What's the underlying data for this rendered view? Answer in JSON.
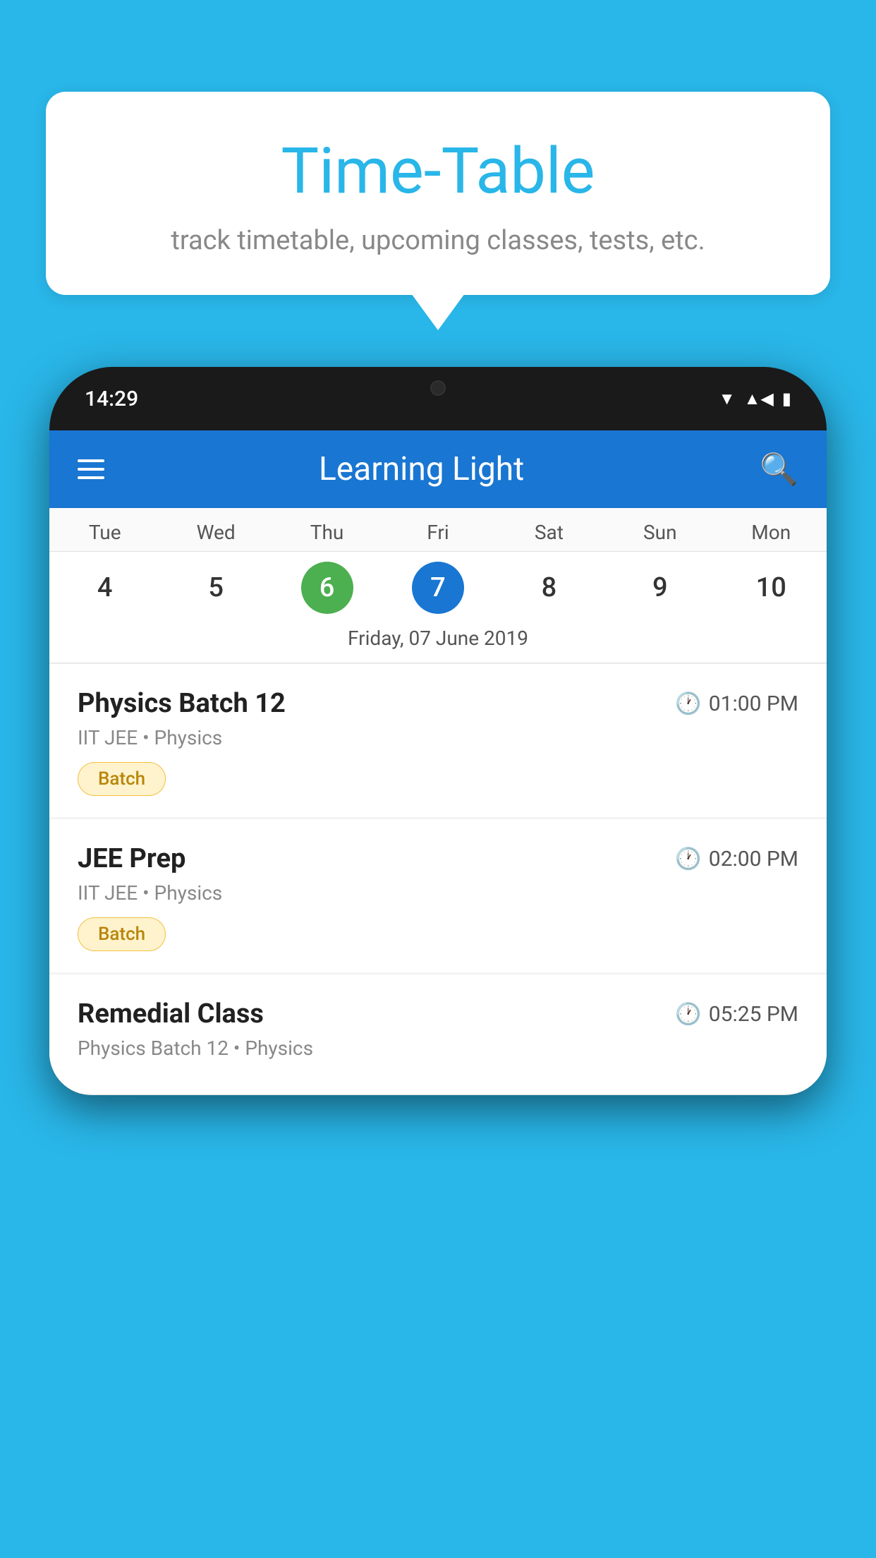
{
  "background_color": "#29B6E8",
  "speech_bubble": {
    "title": "Time-Table",
    "subtitle": "track timetable, upcoming classes, tests, etc."
  },
  "phone": {
    "time": "14:29",
    "app_bar": {
      "title": "Learning Light"
    },
    "calendar": {
      "days": [
        {
          "name": "Tue",
          "number": "4",
          "state": "normal"
        },
        {
          "name": "Wed",
          "number": "5",
          "state": "normal"
        },
        {
          "name": "Thu",
          "number": "6",
          "state": "today"
        },
        {
          "name": "Fri",
          "number": "7",
          "state": "selected"
        },
        {
          "name": "Sat",
          "number": "8",
          "state": "normal"
        },
        {
          "name": "Sun",
          "number": "9",
          "state": "normal"
        },
        {
          "name": "Mon",
          "number": "10",
          "state": "normal"
        }
      ],
      "selected_date": "Friday, 07 June 2019"
    },
    "schedule": [
      {
        "title": "Physics Batch 12",
        "time": "01:00 PM",
        "subtitle": "IIT JEE • Physics",
        "badge": "Batch"
      },
      {
        "title": "JEE Prep",
        "time": "02:00 PM",
        "subtitle": "IIT JEE • Physics",
        "badge": "Batch"
      },
      {
        "title": "Remedial Class",
        "time": "05:25 PM",
        "subtitle": "Physics Batch 12 • Physics",
        "badge": null
      }
    ]
  },
  "icons": {
    "hamburger": "☰",
    "search": "🔍",
    "clock": "⏱"
  }
}
